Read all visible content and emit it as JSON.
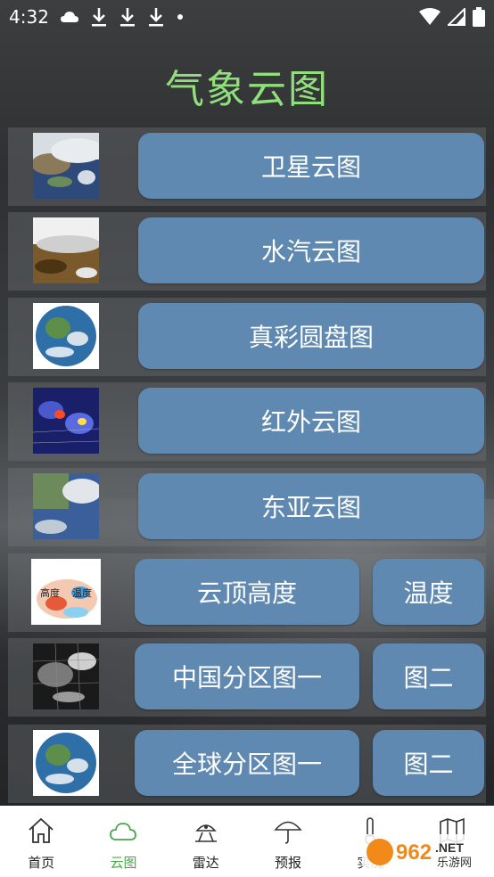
{
  "status_bar": {
    "time": "4:32"
  },
  "page": {
    "title": "气象云图"
  },
  "rows": [
    {
      "button": "卫星云图"
    },
    {
      "button": "水汽云图"
    },
    {
      "button": "真彩圆盘图"
    },
    {
      "button": "红外云图"
    },
    {
      "button": "东亚云图"
    },
    {
      "button": "云顶高度",
      "secondary": "温度",
      "thumb_text_left": "高度",
      "thumb_text_right": "温度"
    },
    {
      "button": "中国分区图一",
      "secondary": "图二"
    },
    {
      "button": "全球分区图一",
      "secondary": "图二"
    }
  ],
  "tabs": [
    {
      "label": "首页",
      "icon": "home-icon"
    },
    {
      "label": "云图",
      "icon": "cloud-icon",
      "active": true
    },
    {
      "label": "雷达",
      "icon": "radar-icon"
    },
    {
      "label": "预报",
      "icon": "umbrella-icon"
    },
    {
      "label": "实况",
      "icon": "thermometer-icon"
    },
    {
      "label": "",
      "icon": "map-icon"
    }
  ],
  "watermark": {
    "brand": "962",
    "net": ".NET",
    "site": "乐游网"
  },
  "colors": {
    "title": "#8fe07a",
    "button": "#5f89b0",
    "tab_active": "#4aa84a"
  }
}
